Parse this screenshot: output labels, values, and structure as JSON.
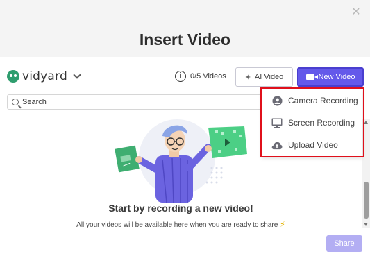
{
  "modal": {
    "title": "Insert Video",
    "close_glyph": "✕"
  },
  "brand": {
    "logo_text": "vidyard",
    "logo_color": "#2e9d6e"
  },
  "toolbar": {
    "info_glyph": "i",
    "video_count": "0/5 Videos",
    "ai_button_label": "AI Video",
    "new_video_label": "New Video",
    "accent_color": "#6459ea"
  },
  "search": {
    "placeholder": "Search",
    "value": ""
  },
  "dropdown": {
    "items": [
      {
        "label": "Camera Recording",
        "icon": "camera-user-icon"
      },
      {
        "label": "Screen Recording",
        "icon": "monitor-icon"
      },
      {
        "label": "Upload Video",
        "icon": "cloud-upload-icon"
      }
    ],
    "highlight_color": "#e0101b"
  },
  "empty_state": {
    "title": "Start by recording a new video!",
    "subtitle": "All your videos will be available here when you are ready to share",
    "bolt_glyph": "⚡"
  },
  "footer": {
    "share_label": "Share"
  }
}
